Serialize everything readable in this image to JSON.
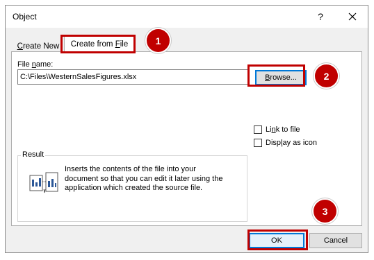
{
  "window": {
    "title": "Object",
    "help_glyph": "?"
  },
  "tabs": [
    {
      "label": "Create New",
      "selected": false
    },
    {
      "label": "Create from File",
      "selected": true
    }
  ],
  "form": {
    "file_name_label": "File name:",
    "file_name_value": "C:\\Files\\WesternSalesFigures.xlsx",
    "browse_label": "Browse...",
    "link_to_file_label": "Link to file",
    "link_to_file_checked": false,
    "display_as_icon_label": "Display as icon",
    "display_as_icon_checked": false
  },
  "result": {
    "legend": "Result",
    "text": "Inserts the contents of the file into your document so that you can edit it later using the application which created the source file.",
    "icon": "embedded-document-icon"
  },
  "buttons": {
    "ok_label": "OK",
    "cancel_label": "Cancel"
  },
  "annotations": {
    "step1": "1",
    "step2": "2",
    "step3": "3"
  },
  "colors": {
    "highlight": "#c00000",
    "focus": "#0078d7"
  }
}
